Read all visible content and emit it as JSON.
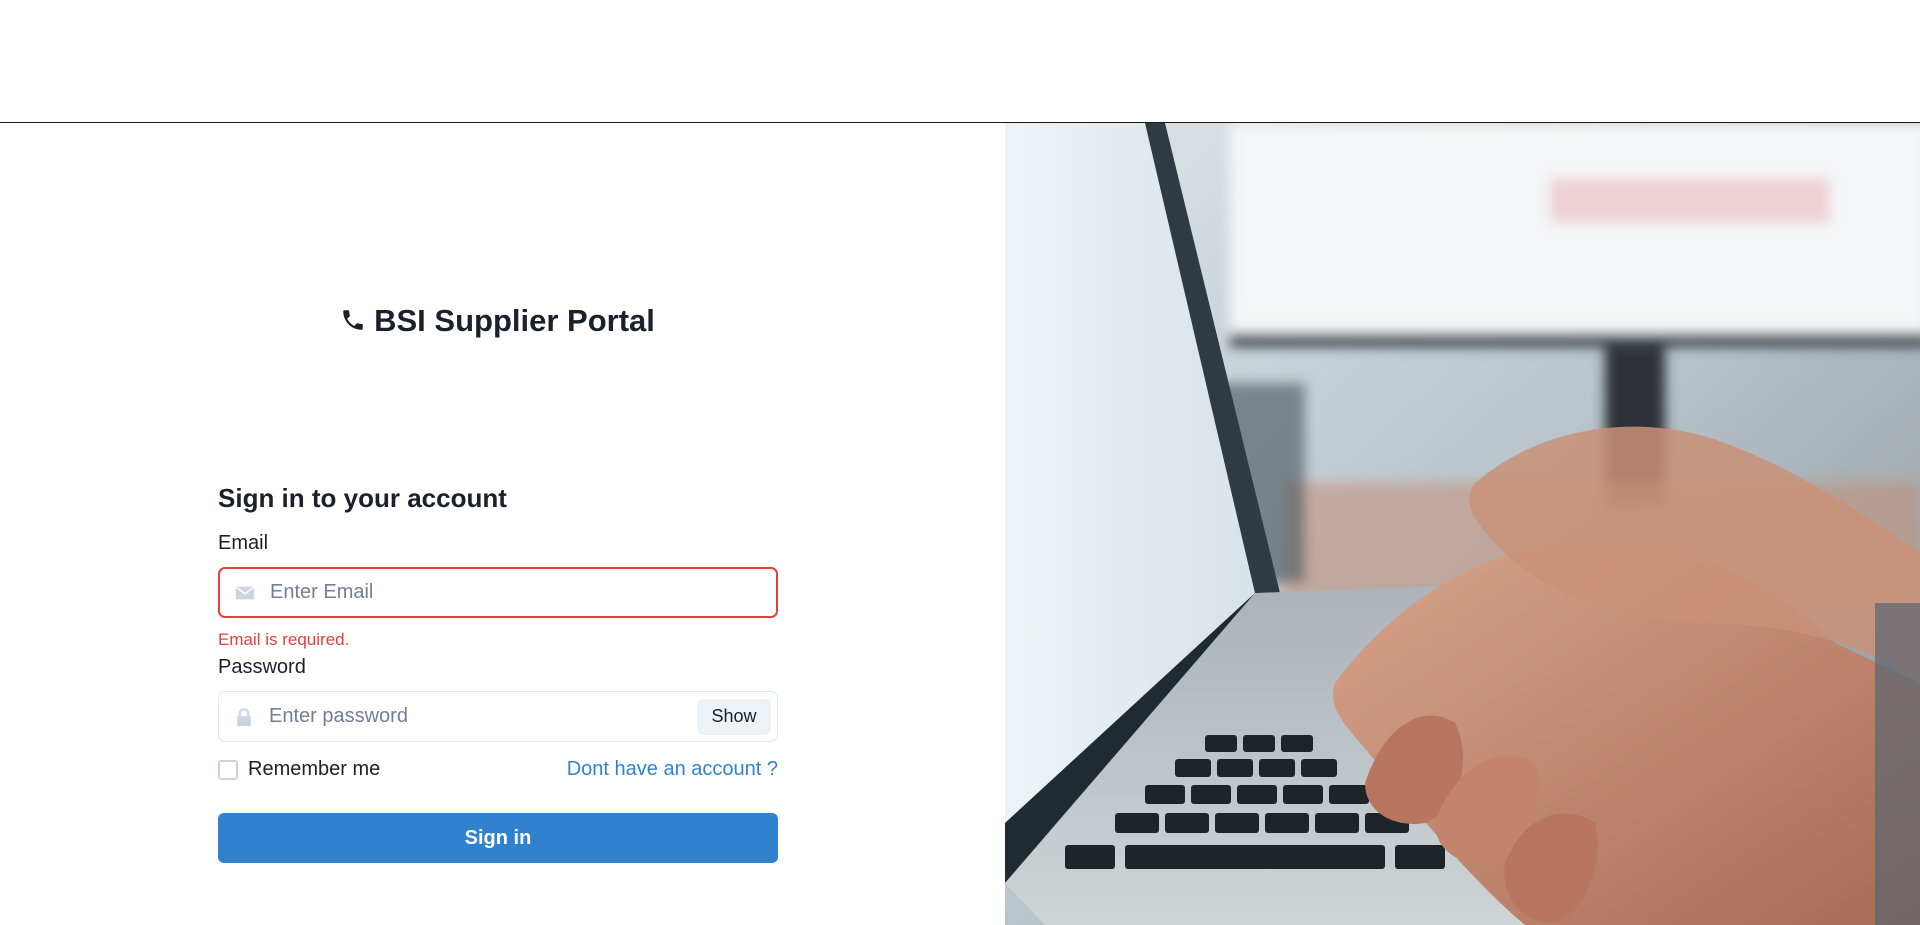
{
  "brand": {
    "title": "BSI Supplier Portal",
    "icon": "phone-icon"
  },
  "form": {
    "heading": "Sign in to your account",
    "email": {
      "label": "Email",
      "placeholder": "Enter Email",
      "value": "",
      "icon": "envelope-icon",
      "error": "Email is required."
    },
    "password": {
      "label": "Password",
      "placeholder": "Enter password",
      "value": "",
      "icon": "lock-icon",
      "toggle_label": "Show"
    },
    "remember_label": "Remember me",
    "remember_checked": false,
    "signup_link": "Dont have an account ?",
    "submit_label": "Sign in"
  },
  "colors": {
    "accent": "#3182ce",
    "error": "#e53e3e"
  },
  "hero_image": {
    "subject": "hands typing on laptop keyboard"
  }
}
